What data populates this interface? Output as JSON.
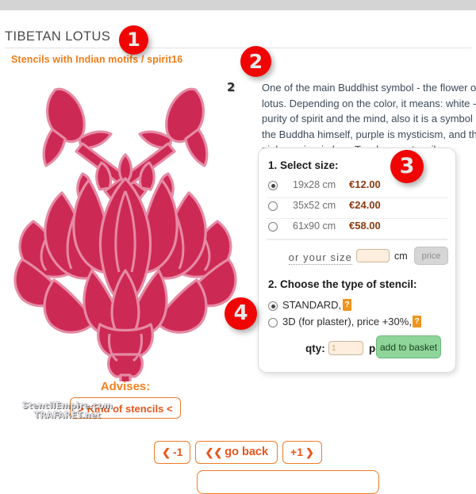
{
  "header": {
    "title": "TIBETAN LOTUS",
    "breadcrumb": "Stencils with Indian motifs / spirit16"
  },
  "annotations": {
    "badge_1": "1",
    "badge_2": "2",
    "badge_3": "3",
    "badge_4": "4",
    "badge_color": "#f00505"
  },
  "artwork": {
    "watermark_line1": "StencilEmpire.com",
    "watermark_line2": "TRAFARET.net",
    "stencil_color": "#cc2a54",
    "stencil_outline_color": "#e68aa5",
    "layers_glyph": "2"
  },
  "description": {
    "text": "One of the main Buddhist symbol - the flower of lotus. Depending on the color, it means: white - purity of spirit and the mind, also it is a symbol of the Buddha himself, purple is mysticism, and the pink one is wisdom. Two layers stencil."
  },
  "order_panel": {
    "step1_label": "1. Select size:",
    "sizes": [
      {
        "name": "19x28 cm",
        "price": "€12.00",
        "selected": true
      },
      {
        "name": "35x52 cm",
        "price": "€24.00",
        "selected": false
      },
      {
        "name": "61x90 cm",
        "price": "€58.00",
        "selected": false
      }
    ],
    "custom_size": {
      "link_label": "or your size",
      "input_value": "",
      "unit_label": "cm",
      "price_button_label": "price"
    },
    "step2_label": "2. Choose the type of stencil:",
    "types": [
      {
        "label": "STANDARD,",
        "help": "?",
        "selected": true
      },
      {
        "label": "3D (for plaster), price +30%,",
        "help": "?",
        "selected": false
      }
    ],
    "qty_label": "qty:",
    "qty_value": "1",
    "pcs_label": "pcs.",
    "basket_button_label": "add to basket",
    "basket_button_color": "#8fd59a"
  },
  "advises": {
    "title": "Advises:",
    "button_label": "> Kind of stencils <"
  },
  "pager": {
    "prev_label": "-1",
    "prev_icon": "❮",
    "back_label": "go back",
    "back_icon": "❮❮",
    "next_label": "+1",
    "next_icon": "❯",
    "accent_color": "#ef7c28"
  }
}
